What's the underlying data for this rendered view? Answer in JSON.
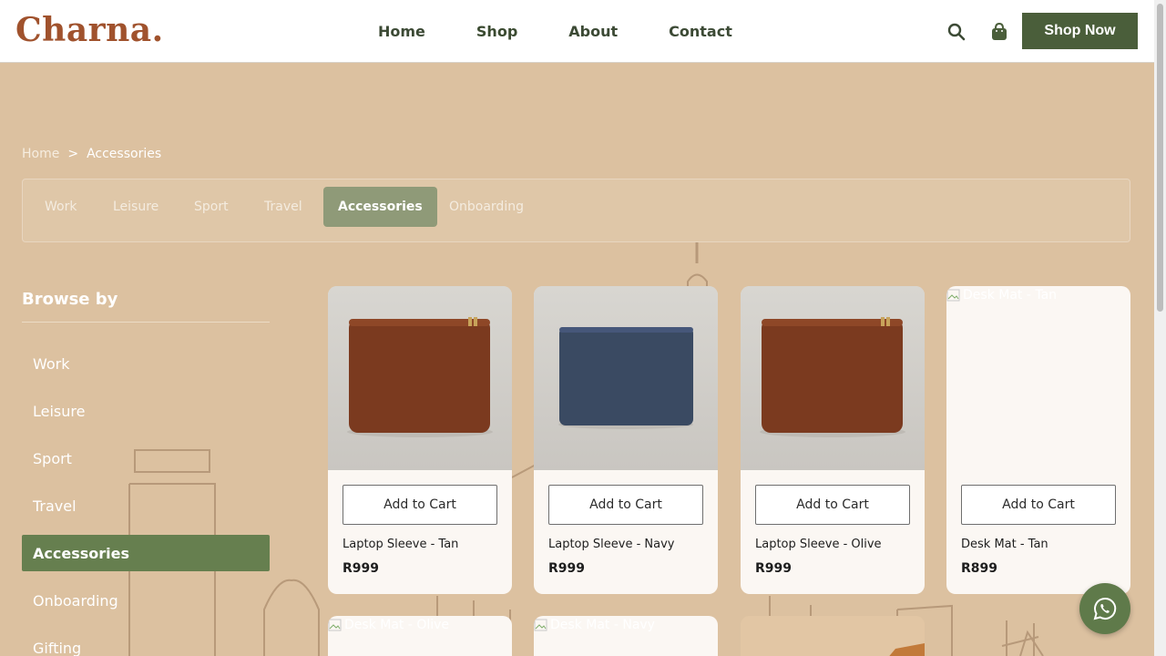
{
  "header": {
    "logo": "Charna.",
    "nav": [
      {
        "label": "Home"
      },
      {
        "label": "Shop"
      },
      {
        "label": "About"
      },
      {
        "label": "Contact"
      }
    ],
    "search_icon": "search-icon",
    "cart_icon": "shopping-bag-icon",
    "cta_label": "Shop Now"
  },
  "breadcrumb": {
    "home": "Home",
    "separator": ">",
    "current": "Accessories"
  },
  "tabs": [
    {
      "label": "Work"
    },
    {
      "label": "Leisure"
    },
    {
      "label": "Sport"
    },
    {
      "label": "Travel"
    },
    {
      "label": "Accessories",
      "active": true
    },
    {
      "label": "Onboarding"
    }
  ],
  "sidebar": {
    "title": "Browse by",
    "items": [
      {
        "label": "Work"
      },
      {
        "label": "Leisure"
      },
      {
        "label": "Sport"
      },
      {
        "label": "Travel"
      },
      {
        "label": "Accessories",
        "active": true
      },
      {
        "label": "Onboarding"
      },
      {
        "label": "Gifting"
      }
    ]
  },
  "products": [
    {
      "name": "Laptop Sleeve - Tan",
      "price": "R999",
      "button": "Add to Cart",
      "color": "#7b3a1f"
    },
    {
      "name": "Laptop Sleeve - Navy",
      "price": "R999",
      "button": "Add to Cart",
      "color": "#3a4a62"
    },
    {
      "name": "Laptop Sleeve - Olive",
      "price": "R999",
      "button": "Add to Cart",
      "color": "#7b3a1f"
    },
    {
      "name": "Desk Mat - Tan",
      "price": "R899",
      "button": "Add to Cart",
      "alt": "Desk Mat - Tan"
    }
  ],
  "products_row2": [
    {
      "alt": "Desk Mat - Olive"
    },
    {
      "alt": "Desk Mat - Navy"
    }
  ],
  "colors": {
    "brand": "#a0522d",
    "accent_green": "#4a5e3a",
    "active_tab": "#8f9a78",
    "active_side": "#667f4f",
    "background": "#dcc1a0"
  },
  "whatsapp_icon": "whatsapp-icon"
}
